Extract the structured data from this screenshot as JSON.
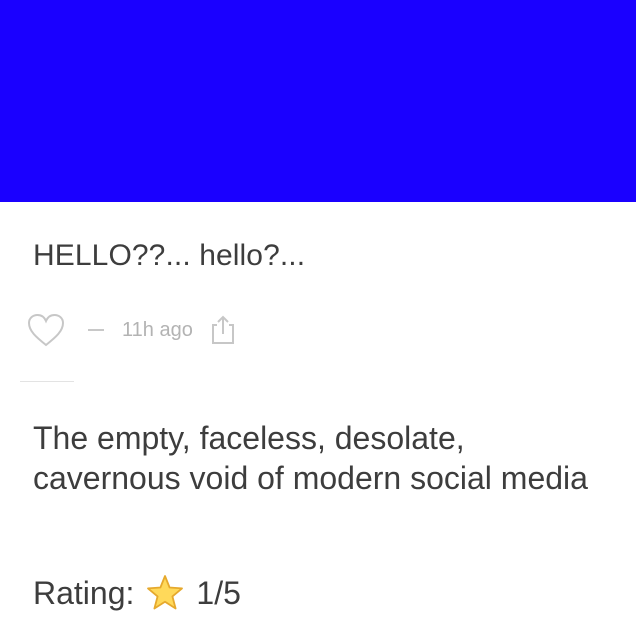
{
  "hero": {
    "color": "#1a00ff"
  },
  "post": {
    "text": "HELLO??... hello?...",
    "time_ago": "11h ago",
    "icons": {
      "like": "heart-icon",
      "separator": "dash",
      "share": "share-icon"
    }
  },
  "description": {
    "text": "The empty, faceless, desolate, cavernous void of modern social media"
  },
  "rating": {
    "label": "Rating:",
    "icon": "star-icon",
    "value": "1/5",
    "score": 1,
    "max": 5
  }
}
